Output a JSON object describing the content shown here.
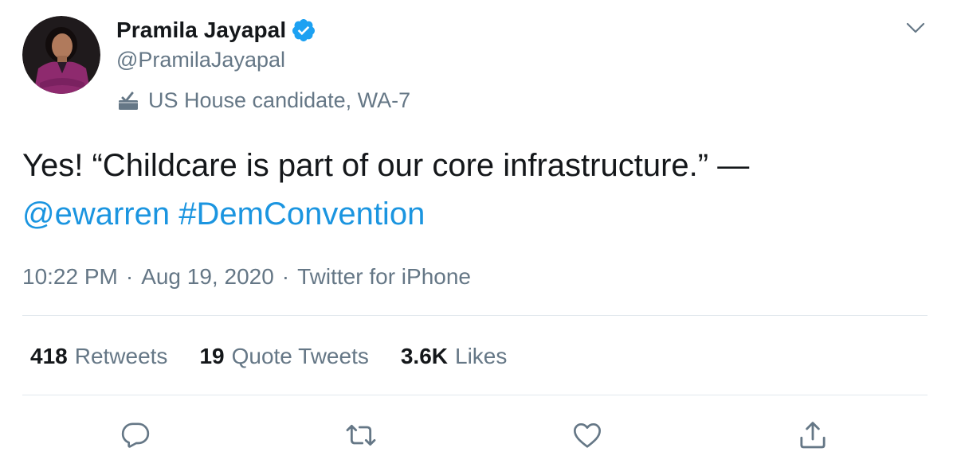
{
  "author": {
    "display_name": "Pramila Jayapal",
    "handle": "@PramilaJayapal",
    "label": "US House candidate, WA-7",
    "verified": true
  },
  "tweet": {
    "text_plain": "Yes! “Childcare is part of our core infrastructure.” —",
    "mention": "@ewarren",
    "hashtag": "#DemConvention"
  },
  "meta": {
    "time": "10:22 PM",
    "date": "Aug 19, 2020",
    "source": "Twitter for iPhone",
    "separator": "·"
  },
  "stats": {
    "retweets_count": "418",
    "retweets_label": "Retweets",
    "quotes_count": "19",
    "quotes_label": "Quote Tweets",
    "likes_count": "3.6K",
    "likes_label": "Likes"
  },
  "icons": {
    "verified": "verified-badge-icon",
    "label": "ballot-box-icon",
    "caret": "chevron-down-icon",
    "reply": "reply-icon",
    "retweet": "retweet-icon",
    "like": "heart-icon",
    "share": "share-icon"
  },
  "colors": {
    "link": "#1b95e0",
    "verified": "#1da1f2",
    "secondary_text": "#657786",
    "icon": "#657786"
  }
}
